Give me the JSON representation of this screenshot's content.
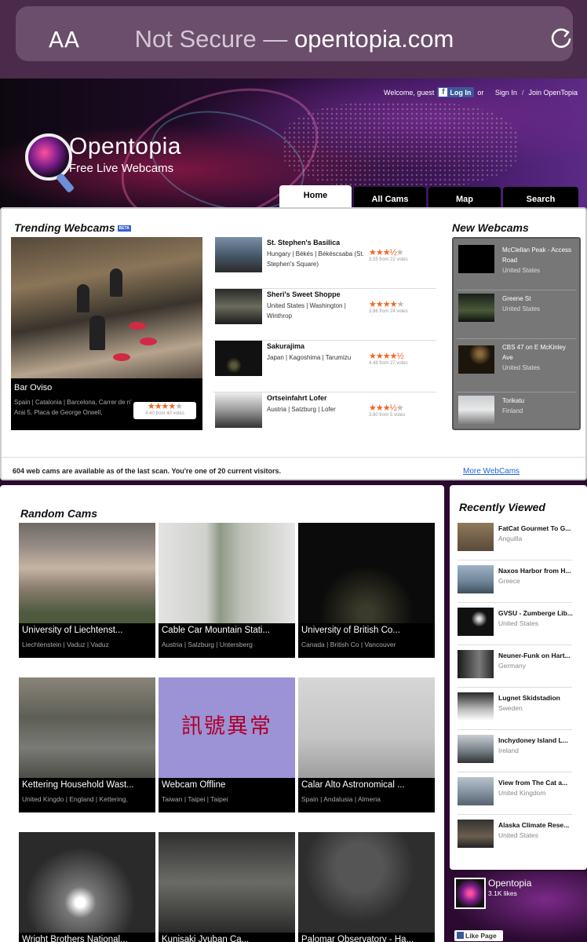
{
  "browser": {
    "text_size_label": "AA",
    "url_prefix": "Not Secure — ",
    "url_domain": "opentopia.com"
  },
  "header": {
    "welcome": "Welcome, guest",
    "fb_login": "Log In",
    "or": "or",
    "sign_in": "Sign In",
    "join": "Join OpenTopia",
    "logo_title": "Opentopia",
    "logo_subtitle": "Free Live Webcams",
    "tabs": [
      "Home",
      "All Cams",
      "Map",
      "Search"
    ]
  },
  "trending": {
    "title": "Trending Webcams",
    "beta": "BETA",
    "featured": {
      "name": "Bar Oviso",
      "location": "Spain | Catalonia | Barcelona, Carrer de n' Arai 5, Placa de George Orwell,",
      "rating": 4.4,
      "votes_text": "4.40 from 40 votes"
    },
    "items": [
      {
        "name": "St. Stephen's Basilica",
        "location": "Hungary | Békés | Békéscsaba (St. Stephen's Square)",
        "rating": 3.55,
        "votes_text": "3.55 from 22 votes"
      },
      {
        "name": "Sheri's Sweet Shoppe",
        "location": "United States | Washington | Winthrop",
        "rating": 3.86,
        "votes_text": "3.86 from 24 votes"
      },
      {
        "name": "Sakurajima",
        "location": "Japan | Kagoshima | Tarumizu",
        "rating": 4.48,
        "votes_text": "4.48 from 27 votes"
      },
      {
        "name": "Ortseinfahrt Lofer",
        "location": "Austria | Salzburg | Lofer",
        "rating": 3.6,
        "votes_text": "3.60 from 5 votes"
      }
    ]
  },
  "new_webcams": {
    "title": "New Webcams",
    "items": [
      {
        "name": "McClellan Peak - Access Road",
        "country": "United States"
      },
      {
        "name": "Greene St",
        "country": "United States"
      },
      {
        "name": "CBS 47 on E McKinley Ave",
        "country": "United States"
      },
      {
        "name": "Torikatu",
        "country": "Finland"
      }
    ]
  },
  "stats": {
    "text": "604 web cams are available as of the last scan. You're one of 20 current visitors.",
    "more_link": "More WebCams"
  },
  "random": {
    "title": "Random Cams",
    "cams": [
      {
        "name": "University of Liechtenst...",
        "location": "Liechtenstein | Vaduz | Vaduz"
      },
      {
        "name": "Cable Car Mountain Stati...",
        "location": "Austria | Salzburg | Untersberg"
      },
      {
        "name": "University of British Co...",
        "location": "Canada | British Co | Vancouver"
      },
      {
        "name": "Kettering Household Wast...",
        "location": "United Kingdo | England | Kettering,"
      },
      {
        "name": "Webcam Offline",
        "location": "Taiwan | Taipei | Taipei",
        "overlay_text": "訊號異常"
      },
      {
        "name": "Calar Alto Astronomical ...",
        "location": "Spain | Andalusia | Almeria"
      },
      {
        "name": "Wright Brothers National...",
        "location": ""
      },
      {
        "name": "Kunisaki Jyuban Ca...",
        "location": ""
      },
      {
        "name": "Palomar Observatory - Ha...",
        "location": ""
      }
    ]
  },
  "recent": {
    "title": "Recently Viewed",
    "items": [
      {
        "name": "FatCat Gourmet To G...",
        "country": "Anguilla"
      },
      {
        "name": "Naxos Harbor from H...",
        "country": "Greece"
      },
      {
        "name": "GVSU - Zumberge Lib...",
        "country": "United States"
      },
      {
        "name": "Neuner-Funk on Hart...",
        "country": "Germany"
      },
      {
        "name": "Lugnet Skidstadion",
        "country": "Sweden"
      },
      {
        "name": "Inchydoney Island L...",
        "country": "Ireland"
      },
      {
        "name": "View from The Cat a...",
        "country": "United Kingdom"
      },
      {
        "name": "Alaska Climate Rese...",
        "country": "United States"
      }
    ]
  },
  "facebook": {
    "page_name": "Opentopia",
    "likes": "3.1K likes",
    "like_button": "Like Page"
  },
  "colors": {
    "accent_star": "#f26522",
    "link": "#1e66d0",
    "fb_blue": "#3b5998"
  }
}
